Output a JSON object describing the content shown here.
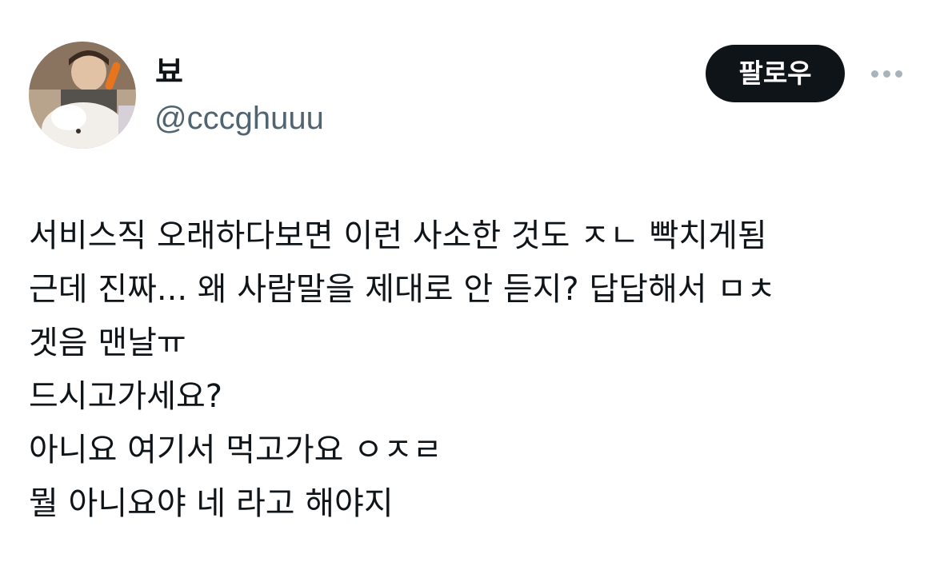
{
  "author": {
    "display_name": "뵤",
    "handle": "@cccghuuu",
    "avatar_icon": "profile-photo"
  },
  "actions": {
    "follow_label": "팔로우",
    "more_icon": "more-horizontal-icon"
  },
  "tweet": {
    "lines": [
      "서비스직 오래하다보면 이런 사소한 것도 ㅈㄴ 빡치게됨",
      "근데 진짜... 왜 사람말을 제대로 안 듣지? 답답해서 ㅁㅊ",
      "겟음 맨날ㅠ",
      "드시고가세요?",
      "아니요 여기서 먹고가요 ㅇㅈㄹ",
      "뭘 아니요야 네 라고 해야지"
    ]
  },
  "colors": {
    "text": "#0f1419",
    "secondary": "#536471",
    "button_bg": "#0f1419",
    "button_text": "#ffffff",
    "more_dots": "#a9b3bb"
  }
}
